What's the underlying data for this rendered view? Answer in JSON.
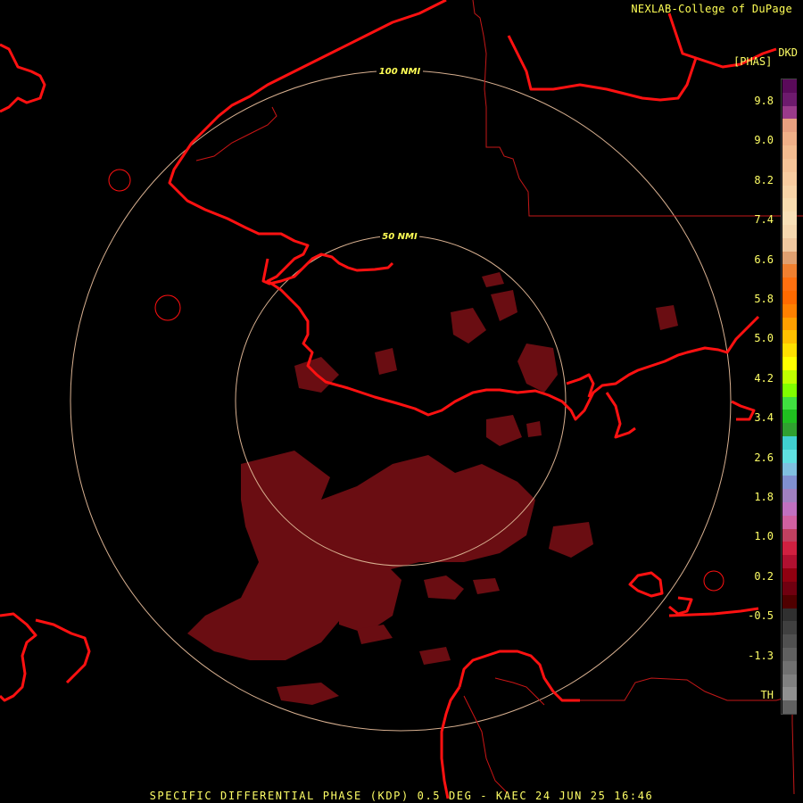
{
  "credit": "NEXLAB-College of DuPage",
  "product_code": "DKD",
  "units": "[PHAS]",
  "footer": "SPECIFIC DIFFERENTIAL PHASE (KDP) 0.5 DEG - KAEC 24 JUN 25 16:46",
  "range_rings": [
    {
      "label": "100 NMI"
    },
    {
      "label": "50 NMI"
    }
  ],
  "colorbar": {
    "ticks": [
      "9.8",
      "9.0",
      "8.2",
      "7.4",
      "6.6",
      "5.8",
      "5.0",
      "4.2",
      "3.4",
      "2.6",
      "1.8",
      "1.0",
      "0.2",
      "-0.5",
      "-1.3",
      "TH"
    ],
    "colors": [
      "#5a0a5a",
      "#6d1a6d",
      "#9a3a8a",
      "#e8a080",
      "#f0b088",
      "#f4bc90",
      "#f6c498",
      "#f8cca0",
      "#f8d4a8",
      "#f8dcb0",
      "#f8e0b8",
      "#f6d8b0",
      "#f0c8a0",
      "#e0a070",
      "#f08030",
      "#ff7010",
      "#ff6a00",
      "#ff8000",
      "#ffa000",
      "#ffc000",
      "#ffe000",
      "#ffff00",
      "#c0ff00",
      "#80ff00",
      "#40e040",
      "#20c020",
      "#30a030",
      "#40d0d0",
      "#60e0e0",
      "#80c0e0",
      "#8090d0",
      "#a080c0",
      "#c070c0",
      "#d060a0",
      "#c04060",
      "#d02040",
      "#b01030",
      "#900010",
      "#700010",
      "#500000",
      "#303030",
      "#404040",
      "#505050",
      "#606060",
      "#707070",
      "#808080",
      "#909090",
      "#606060"
    ]
  },
  "colors": {
    "coast": "#ff1111",
    "borders": "#c41818",
    "rings": "#d8b090",
    "echo": "#6a0d12",
    "text": "#ffff66"
  }
}
